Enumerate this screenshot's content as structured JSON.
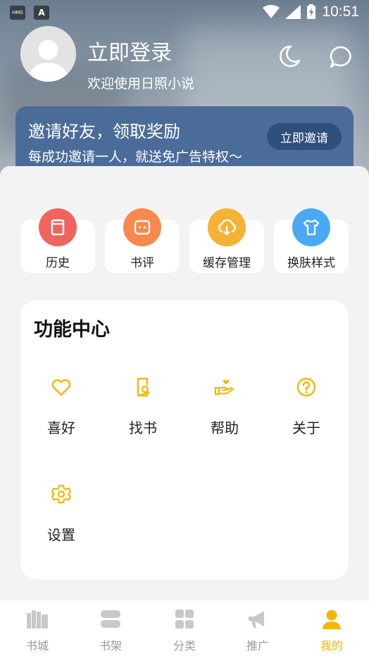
{
  "status_bar": {
    "time": "10:51",
    "left_chips": [
      "HMS",
      "A"
    ]
  },
  "profile": {
    "login_title": "立即登录",
    "welcome": "欢迎使用日照小说"
  },
  "invite": {
    "title": "邀请好友，领取奖励",
    "subtitle": "每成功邀请一人，就送免广告特权～",
    "button": "立即邀请"
  },
  "quick_actions": [
    {
      "label": "历史",
      "icon": "book-icon",
      "color": "#f0645f"
    },
    {
      "label": "书评",
      "icon": "comment-box-icon",
      "color": "#f7884e"
    },
    {
      "label": "缓存管理",
      "icon": "cloud-download-icon",
      "color": "#f6b236"
    },
    {
      "label": "换肤样式",
      "icon": "tshirt-icon",
      "color": "#4aa9f5"
    }
  ],
  "function_center": {
    "title": "功能中心",
    "items": [
      {
        "label": "喜好",
        "icon": "heart-icon"
      },
      {
        "label": "找书",
        "icon": "find-book-icon"
      },
      {
        "label": "帮助",
        "icon": "helping-hand-icon"
      },
      {
        "label": "关于",
        "icon": "question-circle-icon"
      },
      {
        "label": "设置",
        "icon": "gear-icon"
      }
    ]
  },
  "bottom_nav": [
    {
      "label": "书城",
      "icon": "bookstore-icon",
      "active": false
    },
    {
      "label": "书架",
      "icon": "bookshelf-icon",
      "active": false
    },
    {
      "label": "分类",
      "icon": "category-grid-icon",
      "active": false
    },
    {
      "label": "推广",
      "icon": "megaphone-icon",
      "active": false
    },
    {
      "label": "我的",
      "icon": "person-icon",
      "active": true
    }
  ],
  "colors": {
    "accent": "#f2b705",
    "invite_bg": "#4b6c99",
    "invite_button": "#2f4f7b",
    "inactive_nav": "#9a9a9a"
  }
}
